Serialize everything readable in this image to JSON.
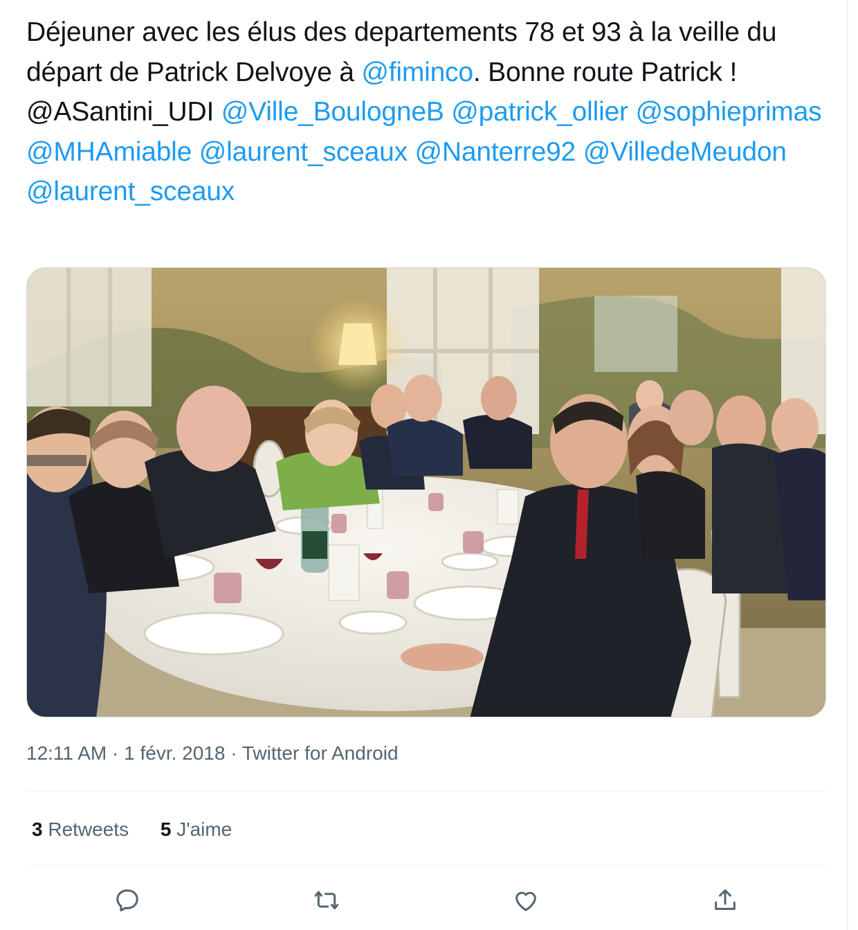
{
  "tweet": {
    "text_parts": [
      {
        "t": "Déjeuner avec les élus des departements 78 et 93 à la veille du départ de Patrick Delvoye à ",
        "mention": false
      },
      {
        "t": "@fiminco",
        "mention": true
      },
      {
        "t": ". Bonne route Patrick ! @ASantini_UDI ",
        "mention": false
      },
      {
        "t": "@Ville_BoulogneB",
        "mention": true
      },
      {
        "t": " ",
        "mention": false
      },
      {
        "t": "@patrick_ollier",
        "mention": true
      },
      {
        "t": " ",
        "mention": false
      },
      {
        "t": "@sophieprimas",
        "mention": true
      },
      {
        "t": " ",
        "mention": false
      },
      {
        "t": "@MHAmiable",
        "mention": true
      },
      {
        "t": " ",
        "mention": false
      },
      {
        "t": "@laurent_sceaux",
        "mention": true
      },
      {
        "t": " ",
        "mention": false
      },
      {
        "t": "@Nanterre92",
        "mention": true
      },
      {
        "t": " ",
        "mention": false
      },
      {
        "t": "@VilledeMeudon",
        "mention": true
      },
      {
        "t": " ",
        "mention": false
      },
      {
        "t": "@laurent_sceaux",
        "mention": true
      }
    ],
    "time": "12:11 AM",
    "separator": " · ",
    "date": "1 févr. 2018",
    "source": "Twitter for Android"
  },
  "stats": {
    "retweets_count": "3",
    "retweets_label": " Retweets",
    "likes_count": "5",
    "likes_label": " J'aime"
  },
  "actions": {
    "reply_icon": "reply-icon",
    "retweet_icon": "retweet-icon",
    "like_icon": "heart-icon",
    "share_icon": "share-icon"
  },
  "colors": {
    "text": "#0f1419",
    "mention": "#1d9bf0",
    "secondary": "#536471",
    "divider": "#eff3f4"
  }
}
